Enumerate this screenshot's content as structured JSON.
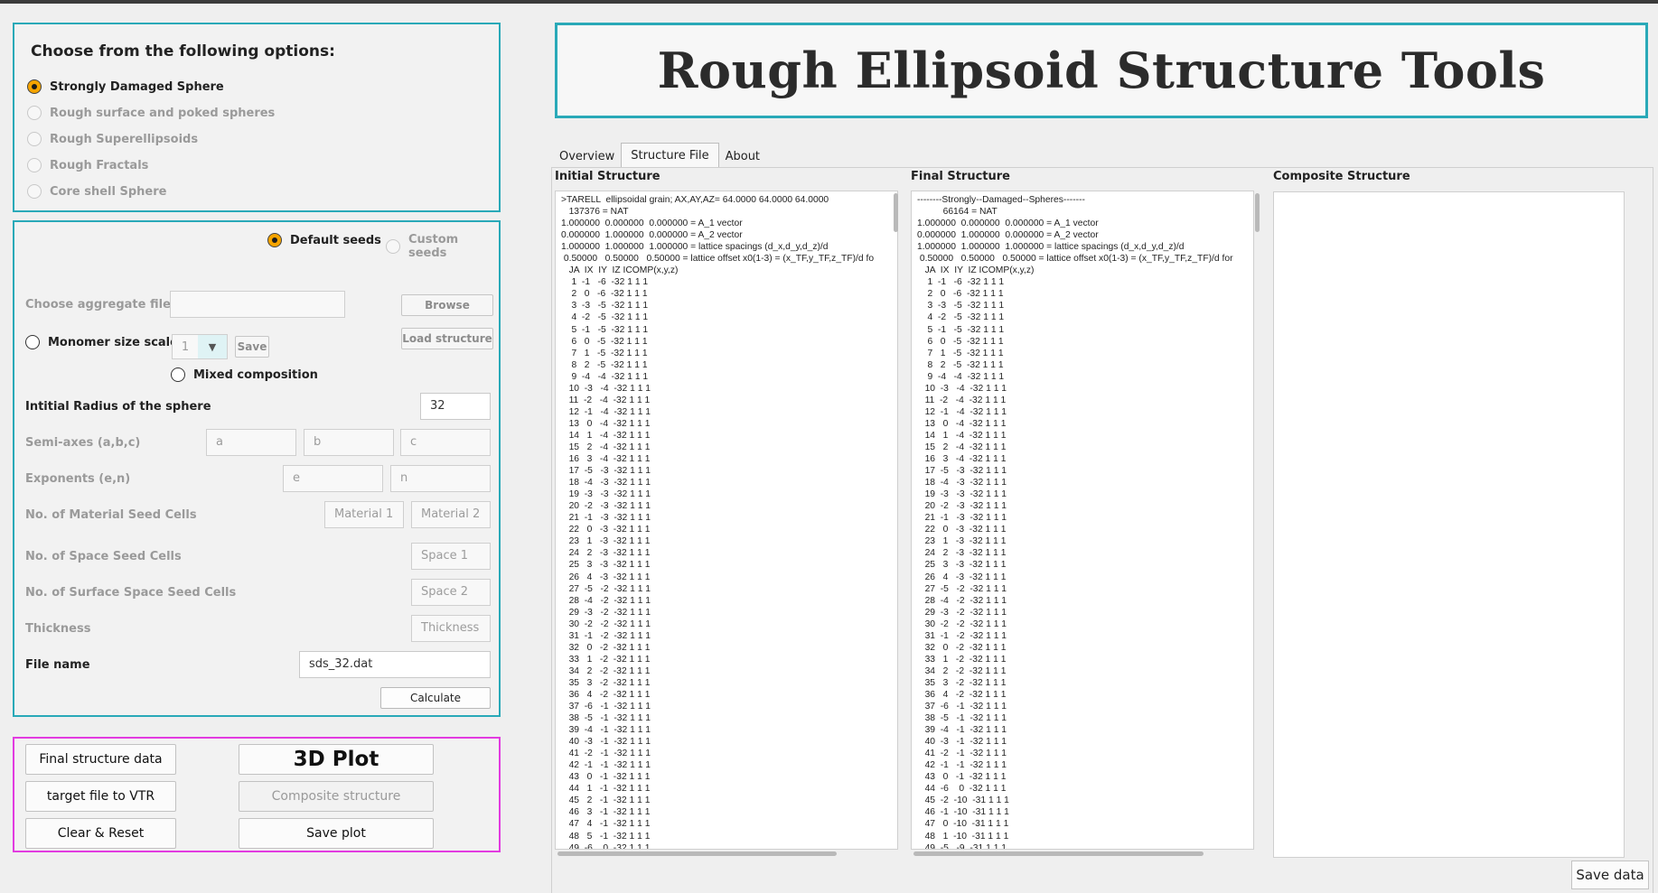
{
  "app": {
    "title": "Rough Ellipsoid Structure Tools"
  },
  "options": {
    "heading": "Choose from the following options:",
    "items": [
      {
        "label": "Strongly Damaged Sphere",
        "selected": true
      },
      {
        "label": "Rough surface and poked spheres",
        "selected": false
      },
      {
        "label": "Rough Superellipsoids",
        "selected": false
      },
      {
        "label": "Rough Fractals",
        "selected": false
      },
      {
        "label": "Core shell Sphere",
        "selected": false
      }
    ]
  },
  "seeds": {
    "default_label": "Default seeds",
    "custom_label": "Custom seeds",
    "selected": "default"
  },
  "params": {
    "aggregate_label": "Choose aggregate file",
    "aggregate_value": "",
    "browse_label": "Browse",
    "monomer_label": "Monomer size scale",
    "monomer_value": "1",
    "monomer_save": "Save",
    "load_structure": "Load structure",
    "mixed_label": "Mixed composition",
    "radius_label": "Intitial Radius of the sphere",
    "radius_value": "32",
    "semiaxes_label": "Semi-axes (a,b,c)",
    "semiaxes_a": "a",
    "semiaxes_b": "b",
    "semiaxes_c": "c",
    "exponents_label": "Exponents (e,n)",
    "exp_e": "e",
    "exp_n": "n",
    "material_label": "No. of Material Seed Cells",
    "material1": "Material 1",
    "material2": "Material 2",
    "space_label": "No. of Space Seed Cells",
    "space1": "Space 1",
    "surface_label": "No. of Surface Space Seed Cells",
    "space2": "Space 2",
    "thickness_label": "Thickness",
    "thickness_placeholder": "Thickness",
    "filename_label": "File name",
    "filename_value": "sds_32.dat",
    "calculate": "Calculate"
  },
  "actions": {
    "final_structure": "Final structure data",
    "plot3d": "3D Plot",
    "target_vtr": "target file to VTR",
    "composite": "Composite structure",
    "clear_reset": "Clear & Reset",
    "save_plot": "Save plot"
  },
  "tabs": [
    {
      "label": "Overview",
      "selected": false
    },
    {
      "label": "Structure File",
      "selected": true
    },
    {
      "label": "About",
      "selected": false
    }
  ],
  "structure": {
    "initial_title": "Initial Structure",
    "final_title": "Final Structure",
    "composite_title": "Composite Structure",
    "initial_text": ">TARELL  ellipsoidal grain; AX,AY,AZ= 64.0000 64.0000 64.0000\n   137376 = NAT\n1.000000  0.000000  0.000000 = A_1 vector\n0.000000  1.000000  0.000000 = A_2 vector\n1.000000  1.000000  1.000000 = lattice spacings (d_x,d_y,d_z)/d\n 0.50000   0.50000   0.50000 = lattice offset x0(1-3) = (x_TF,y_TF,z_TF)/d fo\n   JA  IX  IY  IZ ICOMP(x,y,z)\n    1  -1   -6  -32 1 1 1\n    2   0   -6  -32 1 1 1\n    3  -3   -5  -32 1 1 1\n    4  -2   -5  -32 1 1 1\n    5  -1   -5  -32 1 1 1\n    6   0   -5  -32 1 1 1\n    7   1   -5  -32 1 1 1\n    8   2   -5  -32 1 1 1\n    9  -4   -4  -32 1 1 1\n   10  -3   -4  -32 1 1 1\n   11  -2   -4  -32 1 1 1\n   12  -1   -4  -32 1 1 1\n   13   0   -4  -32 1 1 1\n   14   1   -4  -32 1 1 1\n   15   2   -4  -32 1 1 1\n   16   3   -4  -32 1 1 1\n   17  -5   -3  -32 1 1 1\n   18  -4   -3  -32 1 1 1\n   19  -3   -3  -32 1 1 1\n   20  -2   -3  -32 1 1 1\n   21  -1   -3  -32 1 1 1\n   22   0   -3  -32 1 1 1\n   23   1   -3  -32 1 1 1\n   24   2   -3  -32 1 1 1\n   25   3   -3  -32 1 1 1\n   26   4   -3  -32 1 1 1\n   27  -5   -2  -32 1 1 1\n   28  -4   -2  -32 1 1 1\n   29  -3   -2  -32 1 1 1\n   30  -2   -2  -32 1 1 1\n   31  -1   -2  -32 1 1 1\n   32   0   -2  -32 1 1 1\n   33   1   -2  -32 1 1 1\n   34   2   -2  -32 1 1 1\n   35   3   -2  -32 1 1 1\n   36   4   -2  -32 1 1 1\n   37  -6   -1  -32 1 1 1\n   38  -5   -1  -32 1 1 1\n   39  -4   -1  -32 1 1 1\n   40  -3   -1  -32 1 1 1\n   41  -2   -1  -32 1 1 1\n   42  -1   -1  -32 1 1 1\n   43   0   -1  -32 1 1 1\n   44   1   -1  -32 1 1 1\n   45   2   -1  -32 1 1 1\n   46   3   -1  -32 1 1 1\n   47   4   -1  -32 1 1 1\n   48   5   -1  -32 1 1 1\n   49  -6    0  -32 1 1 1",
    "final_text": "--------Strongly--Damaged--Spheres-------\n          66164 = NAT\n1.000000  0.000000  0.000000 = A_1 vector\n0.000000  1.000000  0.000000 = A_2 vector\n1.000000  1.000000  1.000000 = lattice spacings (d_x,d_y,d_z)/d\n 0.50000   0.50000   0.50000 = lattice offset x0(1-3) = (x_TF,y_TF,z_TF)/d for\n   JA  IX  IY  IZ ICOMP(x,y,z)\n    1  -1   -6  -32 1 1 1\n    2   0   -6  -32 1 1 1\n    3  -3   -5  -32 1 1 1\n    4  -2   -5  -32 1 1 1\n    5  -1   -5  -32 1 1 1\n    6   0   -5  -32 1 1 1\n    7   1   -5  -32 1 1 1\n    8   2   -5  -32 1 1 1\n    9  -4   -4  -32 1 1 1\n   10  -3   -4  -32 1 1 1\n   11  -2   -4  -32 1 1 1\n   12  -1   -4  -32 1 1 1\n   13   0   -4  -32 1 1 1\n   14   1   -4  -32 1 1 1\n   15   2   -4  -32 1 1 1\n   16   3   -4  -32 1 1 1\n   17  -5   -3  -32 1 1 1\n   18  -4   -3  -32 1 1 1\n   19  -3   -3  -32 1 1 1\n   20  -2   -3  -32 1 1 1\n   21  -1   -3  -32 1 1 1\n   22   0   -3  -32 1 1 1\n   23   1   -3  -32 1 1 1\n   24   2   -3  -32 1 1 1\n   25   3   -3  -32 1 1 1\n   26   4   -3  -32 1 1 1\n   27  -5   -2  -32 1 1 1\n   28  -4   -2  -32 1 1 1\n   29  -3   -2  -32 1 1 1\n   30  -2   -2  -32 1 1 1\n   31  -1   -2  -32 1 1 1\n   32   0   -2  -32 1 1 1\n   33   1   -2  -32 1 1 1\n   34   2   -2  -32 1 1 1\n   35   3   -2  -32 1 1 1\n   36   4   -2  -32 1 1 1\n   37  -6   -1  -32 1 1 1\n   38  -5   -1  -32 1 1 1\n   39  -4   -1  -32 1 1 1\n   40  -3   -1  -32 1 1 1\n   41  -2   -1  -32 1 1 1\n   42  -1   -1  -32 1 1 1\n   43   0   -1  -32 1 1 1\n   44  -6    0  -32 1 1 1\n   45  -2  -10  -31 1 1 1\n   46  -1  -10  -31 1 1 1\n   47   0  -10  -31 1 1 1\n   48   1  -10  -31 1 1 1\n   49  -5   -9  -31 1 1 1",
    "composite_text": "",
    "save_data": "Save data"
  }
}
